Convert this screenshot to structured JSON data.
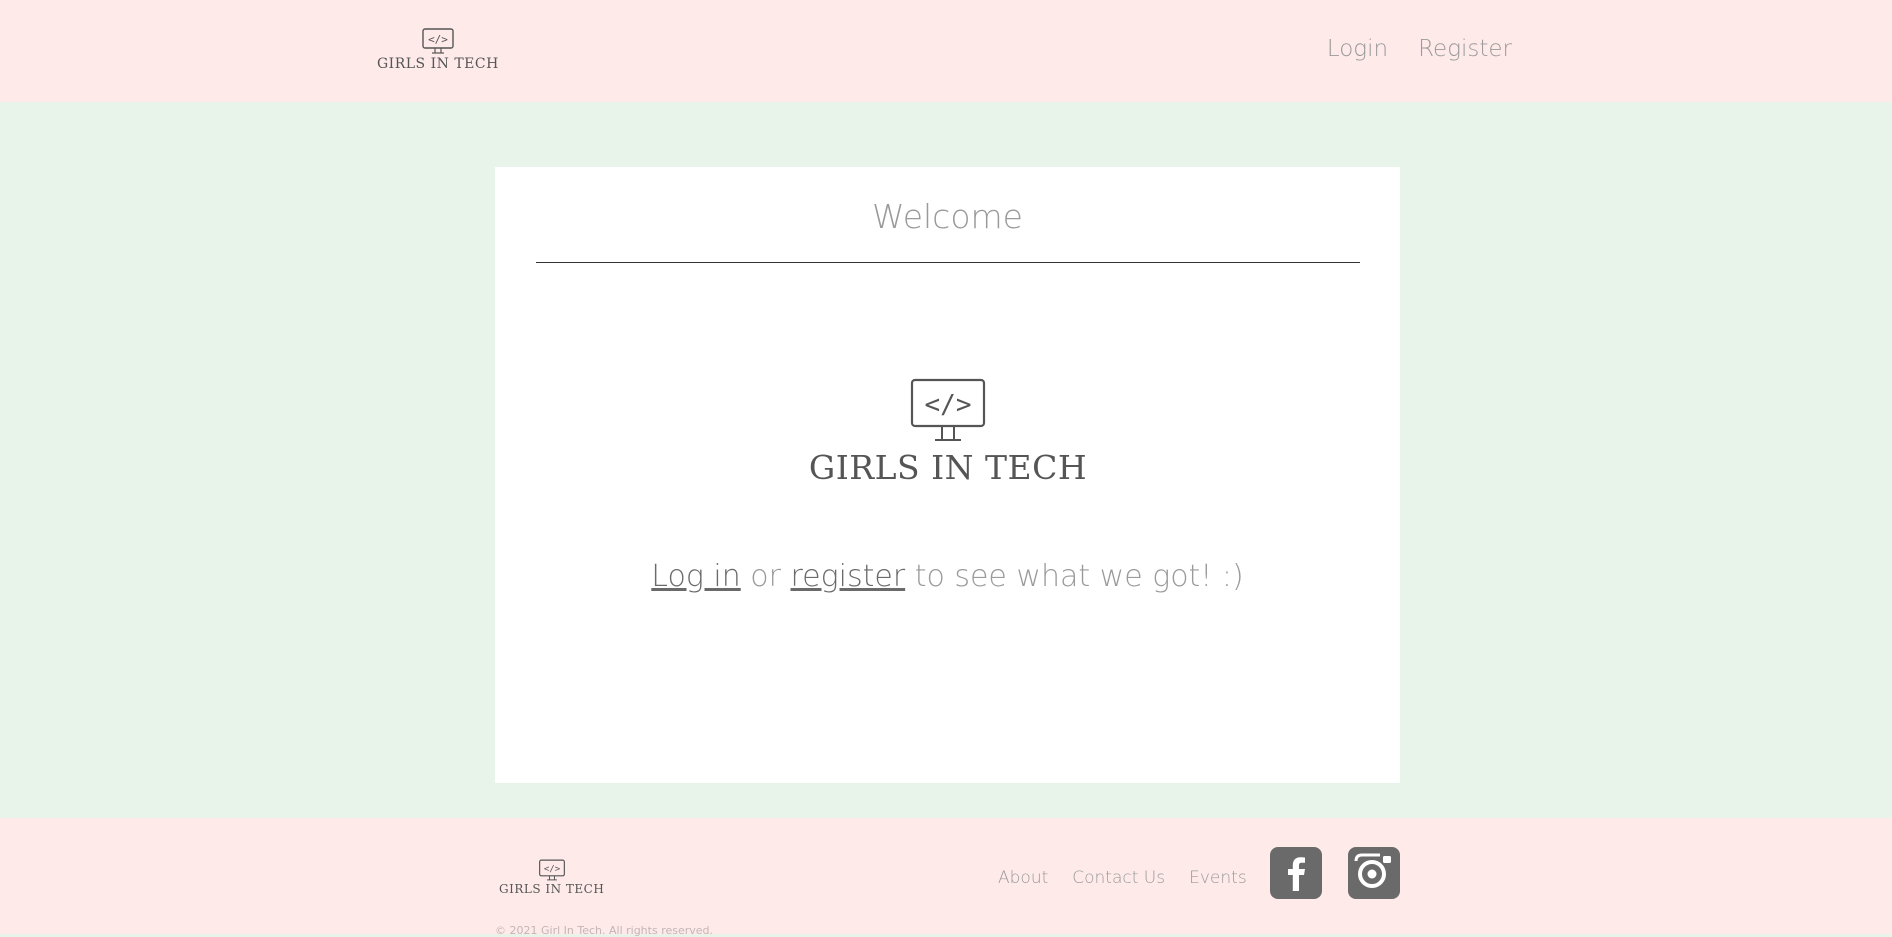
{
  "header": {
    "logo_text": "GIRLS IN TECH",
    "nav": {
      "login": "Login",
      "register": "Register"
    }
  },
  "main": {
    "title": "Welcome",
    "logo_text": "GIRLS IN TECH",
    "cta": {
      "login_link": "Log in",
      "middle": " or ",
      "register_link": "register",
      "suffix": " to see what we got! :)"
    }
  },
  "footer": {
    "logo_text": "GIRLS IN TECH",
    "links": {
      "about": "About",
      "contact": "Contact Us",
      "events": "Events"
    },
    "copyright": "© 2021 Girl In Tech. All rights reserved."
  },
  "icons": {
    "logo": "monitor-code-icon",
    "facebook": "facebook-icon",
    "instagram": "instagram-icon"
  },
  "colors": {
    "header_bg": "#ffeaea",
    "page_bg": "#e8f3e9",
    "card_bg": "#ffffff",
    "text_gray": "#9a9a9a",
    "social_bg": "#6a6a6a"
  }
}
